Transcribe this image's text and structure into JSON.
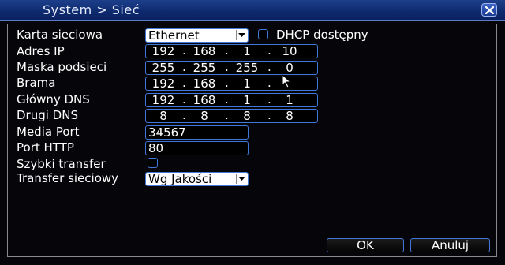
{
  "window": {
    "title": "System > Sieć"
  },
  "form": {
    "network_card": {
      "label": "Karta sieciowa",
      "value": "Ethernet"
    },
    "dhcp": {
      "label": "DHCP dostępny",
      "checked": false
    },
    "ip": {
      "label": "Adres IP",
      "segments": [
        "192",
        "168",
        "1",
        "10"
      ]
    },
    "mask": {
      "label": "Maska podsieci",
      "segments": [
        "255",
        "255",
        "255",
        "0"
      ]
    },
    "gateway": {
      "label": "Brama",
      "segments": [
        "192",
        "168",
        "1",
        ""
      ]
    },
    "primary_dns": {
      "label": "Główny DNS",
      "segments": [
        "192",
        "168",
        "1",
        "1"
      ]
    },
    "secondary_dns": {
      "label": "Drugi DNS",
      "segments": [
        "8",
        "8",
        "8",
        "8"
      ]
    },
    "media_port": {
      "label": "Media Port",
      "value": "34567"
    },
    "http_port": {
      "label": "Port HTTP",
      "value": "80"
    },
    "fast_transfer": {
      "label": "Szybki transfer",
      "checked": false
    },
    "network_transfer": {
      "label": "Transfer sieciowy",
      "value": "Wg Jakości"
    }
  },
  "buttons": {
    "ok": "OK",
    "cancel": "Anuluj"
  },
  "icons": {
    "close": "close-icon",
    "dropdown": "chevron-down-icon",
    "cursor": "mouse-cursor-icon"
  }
}
